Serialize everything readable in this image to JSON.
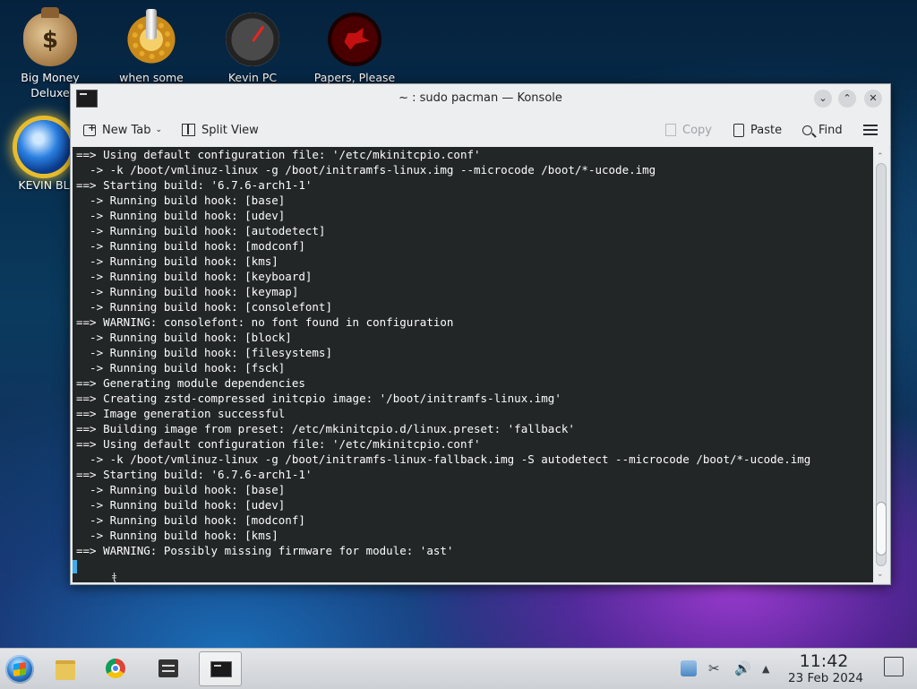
{
  "desktop": {
    "icons": [
      {
        "label": "Big Money",
        "label2": "Deluxe"
      },
      {
        "label": "when some"
      },
      {
        "label": "Kevin PC"
      },
      {
        "label": "Papers, Please"
      },
      {
        "label": "KEVIN BL"
      }
    ]
  },
  "window": {
    "title": "~ : sudo pacman — Konsole",
    "buttons": {
      "minimize": "⌄",
      "maximize": "⌃",
      "close": "✕"
    },
    "toolbar": {
      "new_tab": "New Tab",
      "split_view": "Split View",
      "copy": "Copy",
      "paste": "Paste",
      "find": "Find"
    },
    "terminal_lines": [
      "==> Using default configuration file: '/etc/mkinitcpio.conf'",
      "  -> -k /boot/vmlinuz-linux -g /boot/initramfs-linux.img --microcode /boot/*-ucode.img",
      "==> Starting build: '6.7.6-arch1-1'",
      "  -> Running build hook: [base]",
      "  -> Running build hook: [udev]",
      "  -> Running build hook: [autodetect]",
      "  -> Running build hook: [modconf]",
      "  -> Running build hook: [kms]",
      "  -> Running build hook: [keyboard]",
      "  -> Running build hook: [keymap]",
      "  -> Running build hook: [consolefont]",
      "==> WARNING: consolefont: no font found in configuration",
      "  -> Running build hook: [block]",
      "  -> Running build hook: [filesystems]",
      "  -> Running build hook: [fsck]",
      "==> Generating module dependencies",
      "==> Creating zstd-compressed initcpio image: '/boot/initramfs-linux.img'",
      "==> Image generation successful",
      "==> Building image from preset: /etc/mkinitcpio.d/linux.preset: 'fallback'",
      "==> Using default configuration file: '/etc/mkinitcpio.conf'",
      "  -> -k /boot/vmlinuz-linux -g /boot/initramfs-linux-fallback.img -S autodetect --microcode /boot/*-ucode.img",
      "==> Starting build: '6.7.6-arch1-1'",
      "  -> Running build hook: [base]",
      "  -> Running build hook: [udev]",
      "  -> Running build hook: [modconf]",
      "  -> Running build hook: [kms]",
      "==> WARNING: Possibly missing firmware for module: 'ast'"
    ]
  },
  "taskbar": {
    "clock": {
      "time": "11:42",
      "date": "23 Feb 2024"
    },
    "tray": {
      "scissors": "✂",
      "volume": "🔊",
      "expand": "▲"
    }
  }
}
